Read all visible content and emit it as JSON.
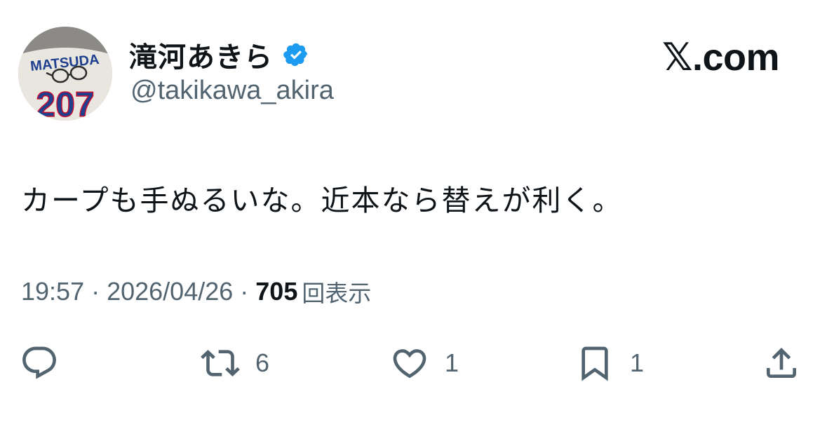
{
  "author": {
    "display_name": "滝河あきら",
    "handle": "@takikawa_akira",
    "verified": true,
    "avatar_jersey_text": "MATSUDA",
    "avatar_jersey_number": "207"
  },
  "brand": {
    "label": "𝕏.com"
  },
  "tweet": {
    "text": "カープも手ぬるいな。近本なら替えが利く。",
    "time": "19:57",
    "date": "2026/04/26",
    "separator": "·",
    "views_count": "705",
    "views_label": "回表示"
  },
  "actions": {
    "reply": {
      "icon": "reply-icon",
      "count": ""
    },
    "retweet": {
      "icon": "retweet-icon",
      "count": "6"
    },
    "like": {
      "icon": "heart-icon",
      "count": "1"
    },
    "bookmark": {
      "icon": "bookmark-icon",
      "count": "1"
    },
    "share": {
      "icon": "share-icon",
      "count": ""
    }
  },
  "colors": {
    "text_primary": "#0f1419",
    "text_secondary": "#536471",
    "verified_blue": "#1d9bf0"
  }
}
